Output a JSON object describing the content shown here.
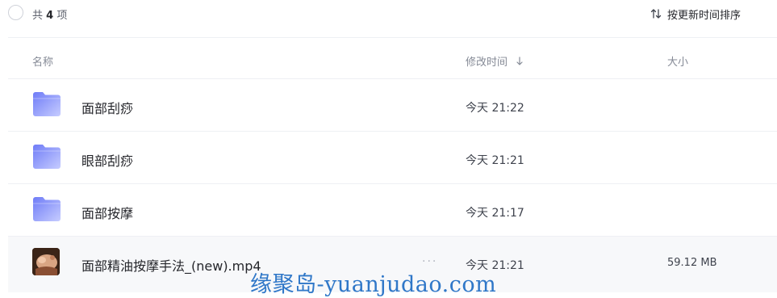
{
  "toolbar": {
    "count_prefix": "共",
    "count_value": "4",
    "count_suffix": "项",
    "sort_label": "按更新时间排序"
  },
  "columns": {
    "name": "名称",
    "modified": "修改时间",
    "size": "大小"
  },
  "files": [
    {
      "name": "面部刮痧",
      "type": "folder",
      "modified": "今天 21:22",
      "size": ""
    },
    {
      "name": "眼部刮痧",
      "type": "folder",
      "modified": "今天 21:21",
      "size": ""
    },
    {
      "name": "面部按摩",
      "type": "folder",
      "modified": "今天 21:17",
      "size": ""
    },
    {
      "name": "面部精油按摩手法_(new).mp4",
      "type": "video",
      "modified": "今天 21:21",
      "size": "59.12 MB",
      "more": "···"
    }
  ],
  "watermark": "缘聚岛-yuanjudao.com",
  "colors": {
    "folder_top": "#6f7cf7",
    "folder_bottom": "#c6ccff",
    "watermark": "#2f77c8"
  },
  "icons": {
    "folder": "folder-icon",
    "sort": "sort-arrows-icon",
    "sort_dir": "arrow-down-icon"
  }
}
